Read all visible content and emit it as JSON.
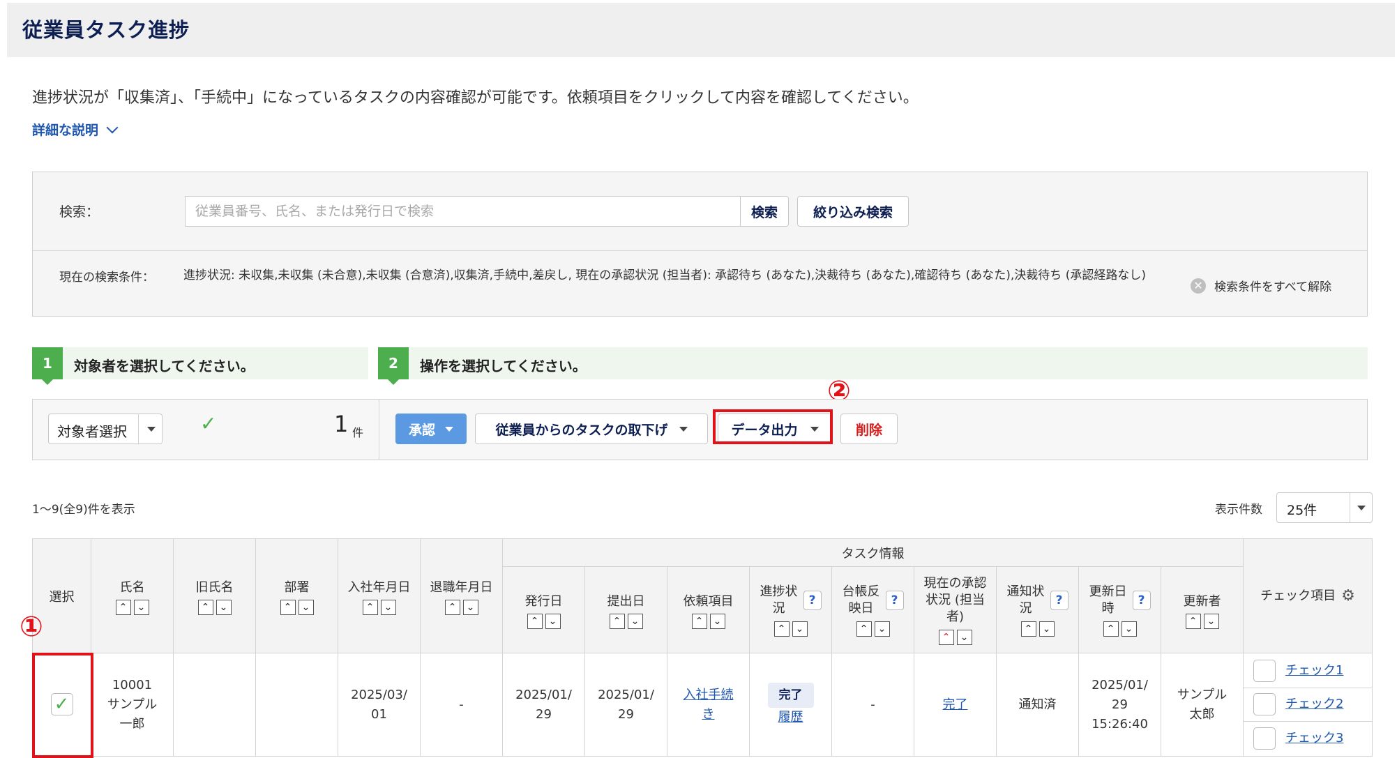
{
  "header": {
    "title": "従業員タスク進捗"
  },
  "description": "進捗状況が「収集済」、「手続中」になっているタスクの内容確認が可能です。依頼項目をクリックして内容を確認してください。",
  "detail_link": "詳細な説明",
  "search": {
    "label": "検索：",
    "placeholder": "従業員番号、氏名、または発行日で検索",
    "search_button": "検索",
    "filter_button": "絞り込み検索",
    "condition_label": "現在の検索条件：",
    "condition_text": "進捗状況: 未収集,未収集 (未合意),未収集 (合意済),収集済,手続中,差戻し, 現在の承認状況 (担当者): 承認待ち (あなた),決裁待ち (あなた),確認待ち (あなた),決裁待ち (承認経路なし)",
    "clear_label": "検索条件をすべて解除"
  },
  "steps": [
    {
      "num": "1",
      "text": "対象者を選択してください。"
    },
    {
      "num": "2",
      "text": "操作を選択してください。"
    }
  ],
  "action": {
    "target_select": "対象者選択",
    "count": "1",
    "count_unit": "件",
    "approve": "承認",
    "withdraw": "従業員からのタスクの取下げ",
    "export": "データ出力",
    "delete": "削除"
  },
  "annotations": {
    "one": "①",
    "two": "②"
  },
  "list": {
    "range_text": "1〜9(全9)件を表示",
    "per_page_label": "表示件数",
    "per_page_value": "25件"
  },
  "table": {
    "group_header": "タスク情報",
    "headers": {
      "select": "選択",
      "name": "氏名",
      "old_name": "旧氏名",
      "dept": "部署",
      "join_date": "入社年月日",
      "leave_date": "退職年月日",
      "issue_date": "発行日",
      "submit_date": "提出日",
      "request_item": "依頼項目",
      "progress_1": "進捗状",
      "progress_2": "況",
      "ledger_1": "台帳反",
      "ledger_2": "映日",
      "approval_1": "現在の承認",
      "approval_2": "状況 (担当",
      "approval_3": "者)",
      "notify_1": "通知状",
      "notify_2": "況",
      "updated_1": "更新日",
      "updated_2": "時",
      "updater": "更新者",
      "check_items": "チェック項目"
    },
    "row": {
      "emp_no": "10001",
      "name_1": "サンプル",
      "name_2": "一郎",
      "join_1": "2025/03/",
      "join_2": "01",
      "leave": "-",
      "issue_1": "2025/01/",
      "issue_2": "29",
      "submit_1": "2025/01/",
      "submit_2": "29",
      "request_1": "入社手続",
      "request_2": "き",
      "status": "完了",
      "history": "履歴",
      "ledger": "-",
      "approval": "完了",
      "notify": "通知済",
      "updated_1": "2025/01/",
      "updated_2": "29",
      "updated_3": "15:26:40",
      "updater_1": "サンプル",
      "updater_2": "太郎",
      "checks": [
        "チェック1",
        "チェック2",
        "チェック3"
      ]
    }
  }
}
